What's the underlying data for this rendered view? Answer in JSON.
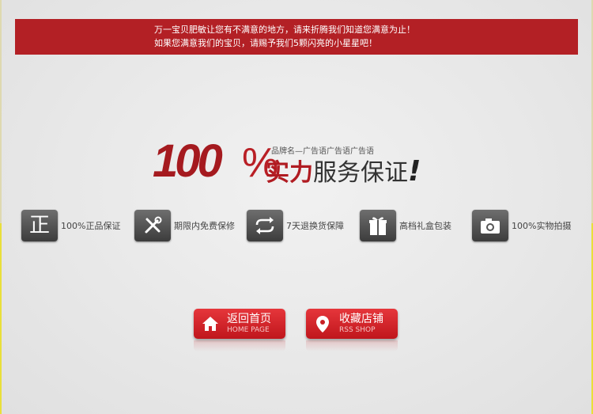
{
  "banner": {
    "line1": "万一宝贝肥敏让您有不满意的地方，请来折腾我们知道您满意为止！",
    "line2": "如果您满意我们的宝贝，请赐予我们5颗闪亮的小星星吧！"
  },
  "hero": {
    "percent_number": "100",
    "percent_sign": "%",
    "tagline": "品牌名—广告语广告语广告语",
    "slogan_red": "实力",
    "slogan_rest": "服务保证",
    "slogan_mark": "!"
  },
  "features": [
    {
      "icon": "zheng-icon",
      "glyph": "正",
      "label": "100%正品保证"
    },
    {
      "icon": "tools-icon",
      "glyph": "",
      "label": "期限内免费保修"
    },
    {
      "icon": "refresh-icon",
      "glyph": "",
      "label": "7天退换货保障"
    },
    {
      "icon": "gift-icon",
      "glyph": "",
      "label": "高档礼盒包装"
    },
    {
      "icon": "camera-icon",
      "glyph": "",
      "label": "100%实物拍摄"
    }
  ],
  "buttons": {
    "home": {
      "label": "返回首页",
      "sub": "HOME PAGE",
      "icon": "home-icon"
    },
    "shop": {
      "label": "收藏店铺",
      "sub": "RSS SHOP",
      "icon": "location-pin-icon"
    }
  },
  "colors": {
    "brand_red": "#b32025",
    "text_dark": "#333333",
    "icon_dark": "#4a4a4a"
  }
}
